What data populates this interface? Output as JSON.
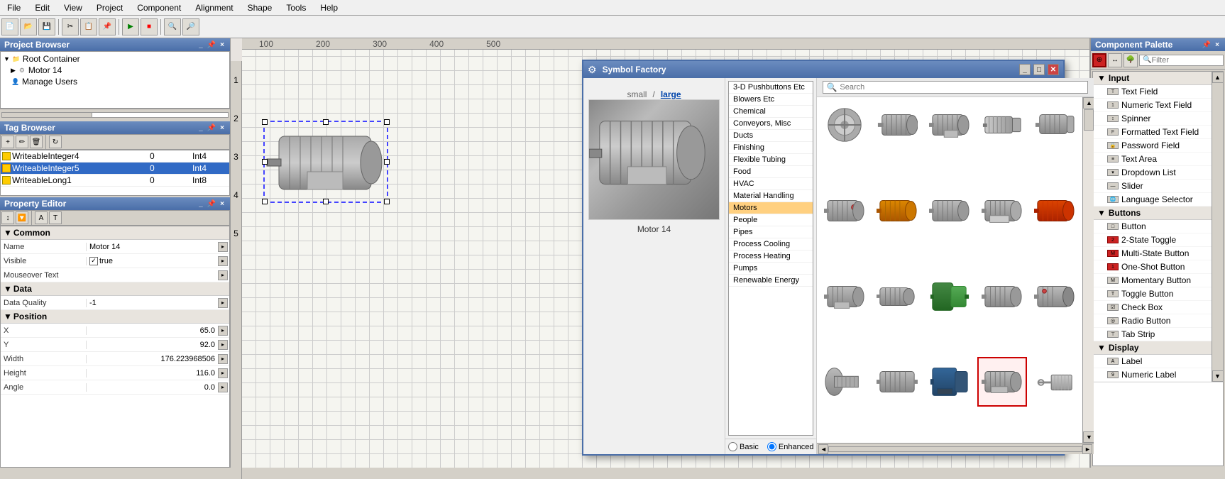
{
  "menu": {
    "items": [
      "File",
      "Edit",
      "View",
      "Project",
      "Component",
      "Alignment",
      "Shape",
      "Tools",
      "Help"
    ]
  },
  "project_browser": {
    "title": "Project Browser",
    "items": [
      {
        "label": "Root Container",
        "type": "folder",
        "indent": 0
      },
      {
        "label": "Motor 14",
        "type": "gear",
        "indent": 1
      },
      {
        "label": "Manage Users",
        "type": "manage",
        "indent": 1
      }
    ]
  },
  "tag_browser": {
    "title": "Tag Browser",
    "tags": [
      {
        "name": "WriteableInteger4",
        "value": "0",
        "type": "Int4"
      },
      {
        "name": "WriteableInteger5",
        "value": "0",
        "type": "Int4"
      },
      {
        "name": "WriteableLong1",
        "value": "0",
        "type": "Int8"
      }
    ]
  },
  "property_editor": {
    "title": "Property Editor",
    "sections": [
      {
        "name": "Common",
        "properties": [
          {
            "label": "Name",
            "value": "Motor 14"
          },
          {
            "label": "Visible",
            "value": "✓ true"
          },
          {
            "label": "Mouseover Text",
            "value": ""
          }
        ]
      },
      {
        "name": "Data",
        "properties": [
          {
            "label": "Data Quality",
            "value": "-1"
          }
        ]
      },
      {
        "name": "Position",
        "properties": [
          {
            "label": "X",
            "value": "65.0"
          },
          {
            "label": "Y",
            "value": "92.0"
          },
          {
            "label": "Width",
            "value": "176.223968506"
          },
          {
            "label": "Height",
            "value": "116.0"
          },
          {
            "label": "Angle",
            "value": "0.0"
          }
        ]
      }
    ]
  },
  "symbol_factory": {
    "title": "Symbol Factory",
    "preview_label": "Motor 14",
    "size_options": [
      "small",
      "large"
    ],
    "active_size": "large",
    "search_placeholder": "Search",
    "categories": [
      "3-D Pushbuttons Etc",
      "Blowers Etc",
      "Chemical",
      "Conveyors, Misc",
      "Ducts",
      "Finishing",
      "Flexible Tubing",
      "Food",
      "HVAC",
      "Material Handling",
      "Motors",
      "People",
      "Pipes",
      "Process Cooling",
      "Process Heating",
      "Pumps",
      "Renewable Energy"
    ],
    "selected_category": "Motors",
    "radio_options": [
      "Basic",
      "Enhanced"
    ],
    "selected_radio": "Enhanced"
  },
  "component_palette": {
    "title": "Component Palette",
    "filter_placeholder": "Filter",
    "sections": [
      {
        "name": "Input",
        "items": [
          {
            "label": "Text Field",
            "icon": "tf"
          },
          {
            "label": "Numeric Text Field",
            "icon": "ntf"
          },
          {
            "label": "Spinner",
            "icon": "sp"
          },
          {
            "label": "Formatted Text Field",
            "icon": "ftf"
          },
          {
            "label": "Password Field",
            "icon": "pf"
          },
          {
            "label": "Text Area",
            "icon": "ta"
          },
          {
            "label": "Dropdown List",
            "icon": "dl"
          },
          {
            "label": "Slider",
            "icon": "sl"
          },
          {
            "label": "Language Selector",
            "icon": "ls"
          }
        ]
      },
      {
        "name": "Buttons",
        "items": [
          {
            "label": "Button",
            "icon": "bt"
          },
          {
            "label": "2-State Toggle",
            "icon": "2t"
          },
          {
            "label": "Multi-State Button",
            "icon": "ms"
          },
          {
            "label": "One-Shot Button",
            "icon": "os"
          },
          {
            "label": "Momentary Button",
            "icon": "mb"
          },
          {
            "label": "Toggle Button",
            "icon": "tb"
          },
          {
            "label": "Check Box",
            "icon": "cb"
          },
          {
            "label": "Radio Button",
            "icon": "rb"
          },
          {
            "label": "Tab Strip",
            "icon": "ts"
          }
        ]
      },
      {
        "name": "Display",
        "items": [
          {
            "label": "Label",
            "icon": "lb"
          },
          {
            "label": "Numeric Label",
            "icon": "nl"
          }
        ]
      }
    ]
  }
}
